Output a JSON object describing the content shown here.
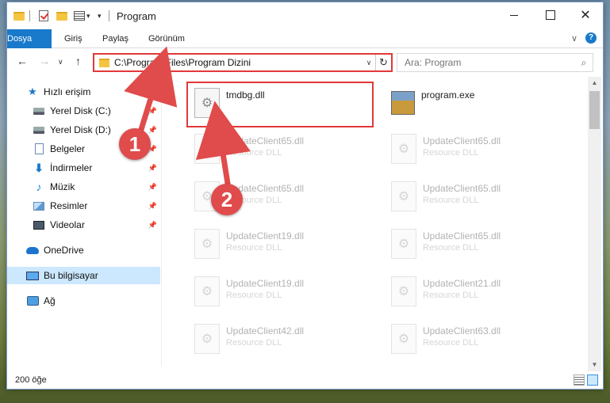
{
  "window": {
    "title": "Program",
    "minimize_label": "",
    "close_label": "✕"
  },
  "ribbon": {
    "tabs": [
      "Dosya",
      "Giriş",
      "Paylaş",
      "Görünüm"
    ],
    "help_label": "?",
    "collapse_glyph": "∨"
  },
  "nav": {
    "back_glyph": "←",
    "forward_glyph": "→",
    "recent_glyph": "∨",
    "up_glyph": "↑",
    "address_path": "C:\\Program Files\\Program Dizini",
    "address_drop_glyph": "∨",
    "refresh_glyph": "↻",
    "search_placeholder": "Ara: Program"
  },
  "sidebar": {
    "items": [
      {
        "label": "Hızlı erişim",
        "icon": "star-icon",
        "pinned": false
      },
      {
        "label": "Yerel Disk (C:)",
        "icon": "disk-icon",
        "pinned": true
      },
      {
        "label": "Yerel Disk (D:)",
        "icon": "disk-icon",
        "pinned": true
      },
      {
        "label": "Belgeler",
        "icon": "document-icon",
        "pinned": true
      },
      {
        "label": "İndirmeler",
        "icon": "download-icon",
        "pinned": true
      },
      {
        "label": "Müzik",
        "icon": "music-icon",
        "pinned": true
      },
      {
        "label": "Resimler",
        "icon": "pictures-icon",
        "pinned": true
      },
      {
        "label": "Videolar",
        "icon": "videos-icon",
        "pinned": true
      },
      {
        "label": "OneDrive",
        "icon": "cloud-icon",
        "pinned": false
      },
      {
        "label": "Bu bilgisayar",
        "icon": "computer-icon",
        "pinned": false,
        "selected": true
      },
      {
        "label": "Ağ",
        "icon": "network-icon",
        "pinned": false
      }
    ]
  },
  "files": [
    {
      "name": "tmdbg.dll",
      "type": "",
      "highlighted": true
    },
    {
      "name": "program.exe",
      "type": ""
    },
    {
      "name": "UpdateClient65.dll",
      "type": "Resource DLL"
    },
    {
      "name": "UpdateClient65.dll",
      "type": "Resource DLL"
    },
    {
      "name": "UpdateClient65.dll",
      "type": "Resource DLL"
    },
    {
      "name": "UpdateClient65.dll",
      "type": "Resource DLL"
    },
    {
      "name": "UpdateClient19.dll",
      "type": "Resource DLL"
    },
    {
      "name": "UpdateClient65.dll",
      "type": "Resource DLL"
    },
    {
      "name": "UpdateClient19.dll",
      "type": "Resource DLL"
    },
    {
      "name": "UpdateClient21.dll",
      "type": "Resource DLL"
    },
    {
      "name": "UpdateClient42.dll",
      "type": "Resource DLL"
    },
    {
      "name": "UpdateClient63.dll",
      "type": "Resource DLL"
    }
  ],
  "status": {
    "item_count": "200 öğe"
  },
  "annotations": {
    "marker_1": "1",
    "marker_2": "2",
    "accent_color": "#e04b4b"
  }
}
